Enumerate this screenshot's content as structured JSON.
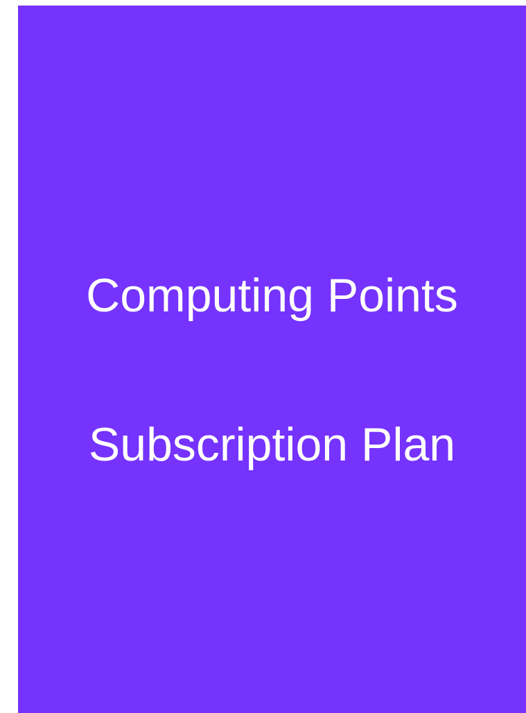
{
  "card": {
    "background_color": "#7533fd",
    "text_color": "#ffffff",
    "title_line_1": "Computing Points",
    "title_line_2": "Subscription Plan"
  }
}
